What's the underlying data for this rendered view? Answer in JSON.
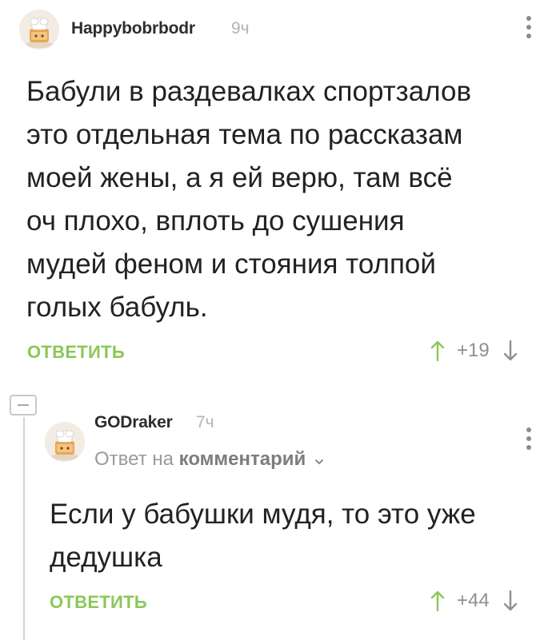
{
  "comment": {
    "username": "Happybobrbodr",
    "time": "9ч",
    "text_lines": [
      "Бабули в раздевалках спортзалов",
      "это отдельная тема по рассказам",
      "моей жены, а я ей верю, там всё",
      "оч плохо, вплоть до сушения",
      "мудей феном и стояния толпой",
      "голых бабуль."
    ],
    "reply_label": "ОТВЕТИТЬ",
    "rating": "+19"
  },
  "reply": {
    "username": "GODraker",
    "time": "7ч",
    "reply_to_prefix": "Ответ на",
    "reply_to_link": "комментарий",
    "text_lines": [
      "Если у бабушки мудя, то это уже",
      "дедушка"
    ],
    "reply_label": "ОТВЕТИТЬ",
    "rating": "+44"
  },
  "colors": {
    "accent_green": "#8ac858",
    "muted": "#9a9a9a",
    "text": "#222222"
  }
}
